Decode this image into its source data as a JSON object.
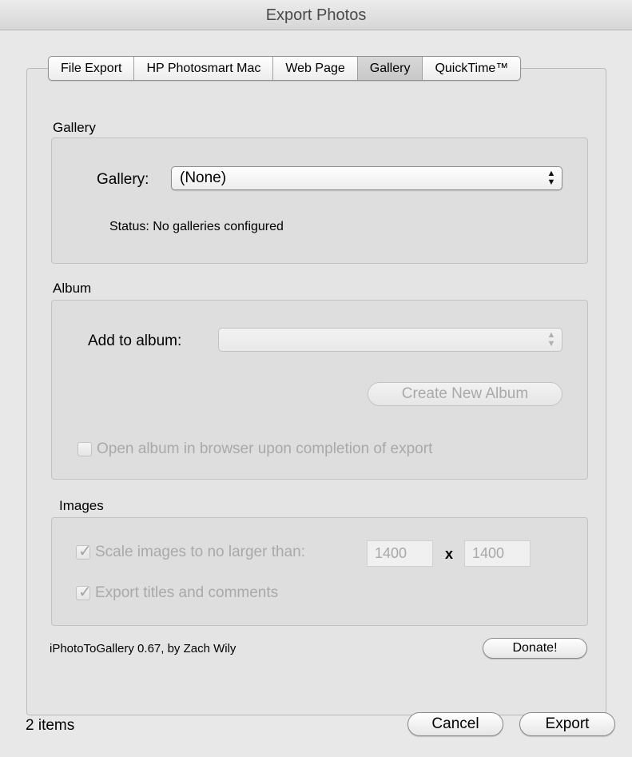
{
  "window": {
    "title": "Export Photos"
  },
  "tabs": [
    {
      "label": "File Export",
      "selected": false
    },
    {
      "label": "HP Photosmart Mac",
      "selected": false
    },
    {
      "label": "Web Page",
      "selected": false
    },
    {
      "label": "Gallery",
      "selected": true
    },
    {
      "label": "QuickTime™",
      "selected": false
    }
  ],
  "gallery_section": {
    "title": "Gallery",
    "gallery_label": "Gallery:",
    "gallery_value": "(None)",
    "status_label": "Status:",
    "status_value": "No galleries configured"
  },
  "album_section": {
    "title": "Album",
    "add_label": "Add to album:",
    "add_value": "",
    "create_button": "Create New Album",
    "open_browser_label": "Open album in browser upon completion of export",
    "open_browser_checked": false
  },
  "images_section": {
    "title": "Images",
    "scale_label": "Scale images to no larger than:",
    "scale_checked": true,
    "width": "1400",
    "times": "x",
    "height": "1400",
    "titles_label": "Export titles and comments",
    "titles_checked": true
  },
  "footer": {
    "credit": "iPhotoToGallery 0.67, by Zach Wily",
    "donate_button": "Donate!",
    "item_count": "2 items",
    "cancel_button": "Cancel",
    "export_button": "Export"
  }
}
